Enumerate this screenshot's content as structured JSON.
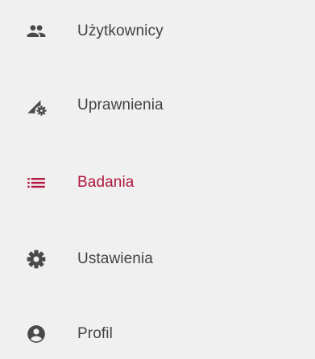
{
  "sidebar": {
    "icon_color": "#4a4a4a",
    "active_color": "#b0163e",
    "items": [
      {
        "label": "Użytkownicy",
        "icon": "users-icon",
        "active": false
      },
      {
        "label": "Uprawnienia",
        "icon": "permissions-icon",
        "active": false
      },
      {
        "label": "Badania",
        "icon": "list-icon",
        "active": true
      },
      {
        "label": "Ustawienia",
        "icon": "settings-icon",
        "active": false
      },
      {
        "label": "Profil",
        "icon": "profile-icon",
        "active": false
      }
    ]
  }
}
